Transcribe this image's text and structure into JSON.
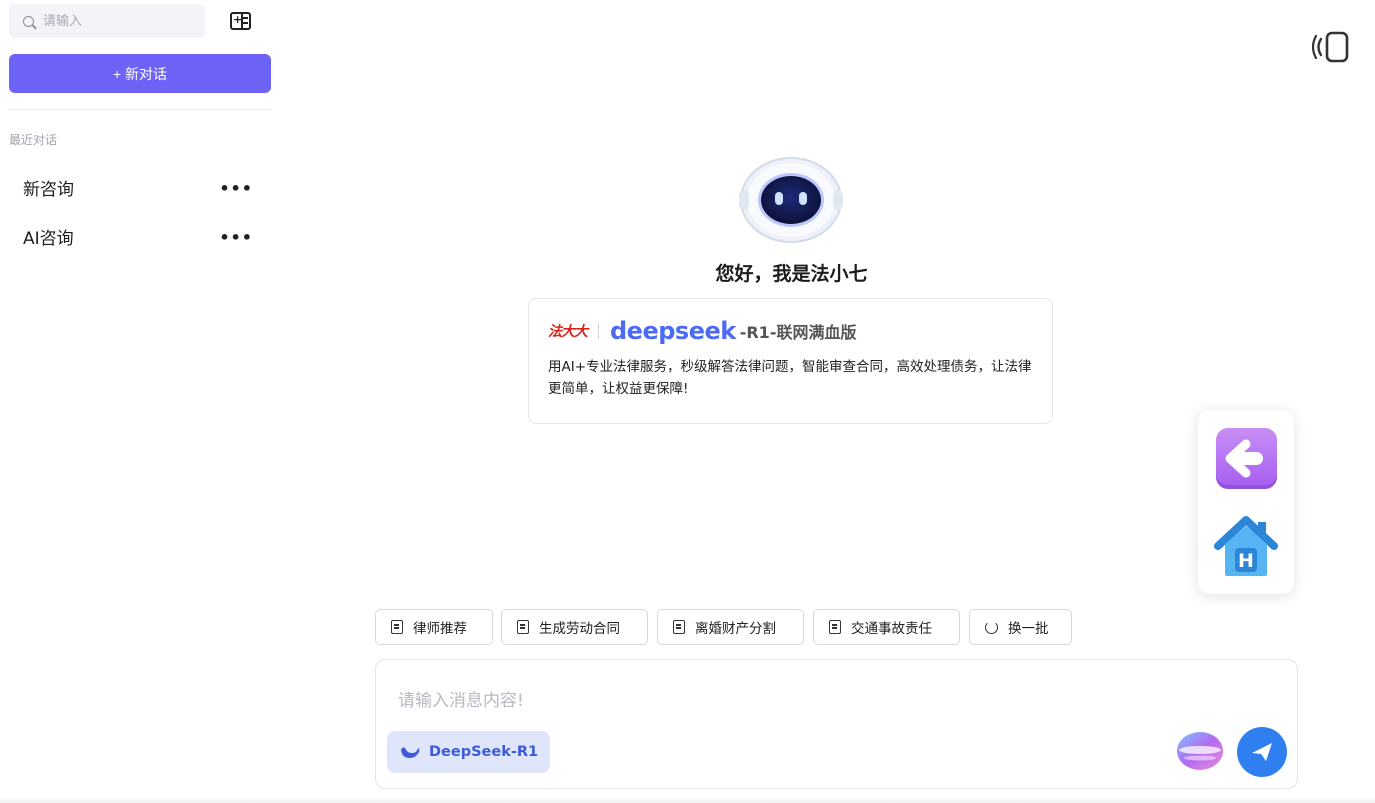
{
  "sidebar": {
    "search_placeholder": "请输入",
    "new_chat_label": "+ 新对话",
    "recent_label": "最近对话",
    "conversations": [
      {
        "title": "新咨询",
        "more": "•••"
      },
      {
        "title": "AI咨询",
        "more": "•••"
      }
    ]
  },
  "hero": {
    "greeting": "您好，我是法小七",
    "brand_logo": "法大大",
    "brand_model": "deepseek",
    "brand_tag": "-R1-联网满血版",
    "description": "用AI+专业法律服务，秒级解答法律问题，智能审查合同，高效处理债务，让法律更简单，让权益更保障!"
  },
  "prompts": [
    {
      "label": "律师推荐",
      "icon": "document-icon"
    },
    {
      "label": "生成劳动合同",
      "icon": "document-icon"
    },
    {
      "label": "离婚财产分割",
      "icon": "document-search-icon"
    },
    {
      "label": "交通事故责任",
      "icon": "document-search-icon"
    },
    {
      "label": "换一批",
      "icon": "refresh-icon"
    }
  ],
  "composer": {
    "placeholder": "请输入消息内容!",
    "model_label": "DeepSeek-R1"
  },
  "colors": {
    "primary": "#6d63f6",
    "send": "#2f7ff0",
    "model_pill_bg": "#dfe6fc",
    "brand_red": "#d8211a",
    "brand_blue": "#4c6bf5"
  },
  "icons": {
    "top_right": "phone-vibrate-icon",
    "float_back": "arrow-left-icon",
    "float_home": "home-h-icon"
  }
}
